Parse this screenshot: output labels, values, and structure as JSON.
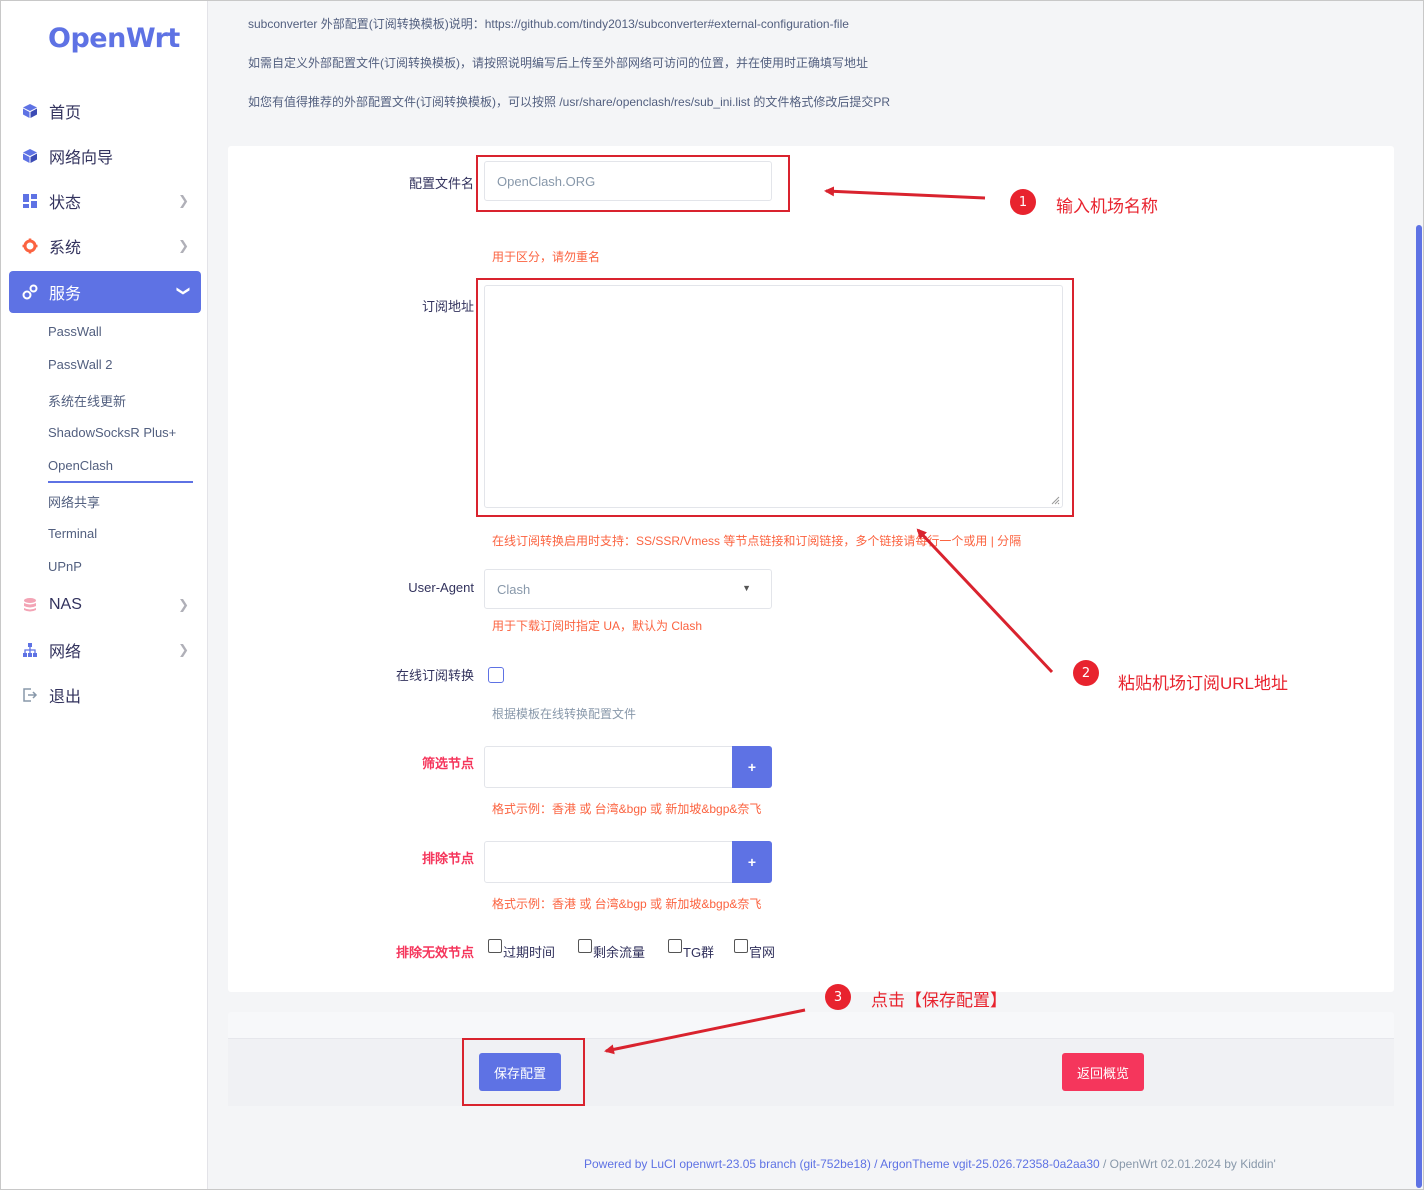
{
  "sidebar": {
    "logo": "OpenWrt",
    "items": [
      {
        "label": "首页",
        "icon": "cube-icon"
      },
      {
        "label": "网络向导",
        "icon": "cube-icon"
      },
      {
        "label": "状态",
        "icon": "dashboard-icon"
      },
      {
        "label": "系统",
        "icon": "gear-icon"
      },
      {
        "label": "服务",
        "icon": "services-icon"
      },
      {
        "label": "NAS",
        "icon": "database-icon"
      },
      {
        "label": "网络",
        "icon": "network-icon"
      },
      {
        "label": "退出",
        "icon": "logout-icon"
      }
    ],
    "services_sub": [
      "PassWall",
      "PassWall 2",
      "系统在线更新",
      "ShadowSocksR Plus+",
      "OpenClash",
      "网络共享",
      "Terminal",
      "UPnP"
    ]
  },
  "info": {
    "line1": "subconverter 外部配置(订阅转换模板)说明：https://github.com/tindy2013/subconverter#external-configuration-file",
    "line2": "如需自定义外部配置文件(订阅转换模板)，请按照说明编写后上传至外部网络可访问的位置，并在使用时正确填写地址",
    "line3": "如您有值得推荐的外部配置文件(订阅转换模板)，可以按照 /usr/share/openclash/res/sub_ini.list 的文件格式修改后提交PR"
  },
  "form": {
    "config_name_label": "配置文件名",
    "config_name_placeholder": "OpenClash.ORG",
    "config_name_hint": "用于区分，请勿重名",
    "sub_url_label": "订阅地址",
    "sub_url_hint": "在线订阅转换启用时支持：SS/SSR/Vmess 等节点链接和订阅链接，多个链接请每行一个或用 | 分隔",
    "ua_label": "User-Agent",
    "ua_value": "Clash",
    "ua_hint": "用于下载订阅时指定 UA，默认为 Clash",
    "convert_label": "在线订阅转换",
    "convert_hint": "根据模板在线转换配置文件",
    "filter_label": "筛选节点",
    "filter_hint": "格式示例：香港 或 台湾&bgp 或 新加坡&bgp&奈飞",
    "exclude_label": "排除节点",
    "exclude_hint": "格式示例：香港 或 台湾&bgp 或 新加坡&bgp&奈飞",
    "plus": "+",
    "invalid_label": "排除无效节点",
    "invalid_options": [
      "过期时间",
      "剩余流量",
      "TG群",
      "官网"
    ]
  },
  "actions": {
    "save": "保存配置",
    "back": "返回概览"
  },
  "footer": {
    "powered": "Powered by LuCI openwrt-23.05 branch (git-752be18) / ArgonTheme vgit-25.026.72358-0a2aa30",
    "version": " / OpenWrt 02.01.2024 by Kiddin'"
  },
  "annotations": {
    "step1_num": "1",
    "step1_text": "输入机场名称",
    "step2_num": "2",
    "step2_text": "粘贴机场订阅URL地址",
    "step3_num": "3",
    "step3_text": "点击【保存配置】"
  },
  "colors": {
    "accent": "#5e72e4",
    "danger": "#f5365c",
    "warning": "#fb6340",
    "annotation": "#e8232e"
  }
}
